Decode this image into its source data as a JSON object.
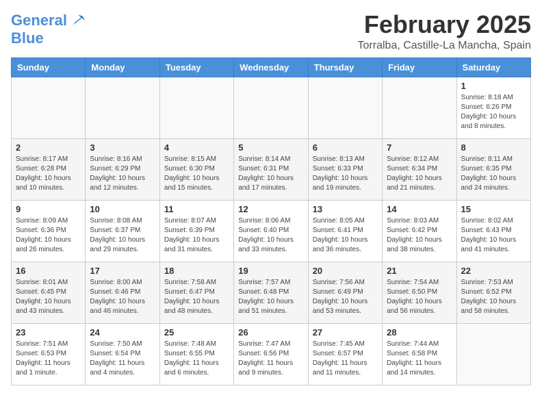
{
  "header": {
    "logo_line1": "General",
    "logo_line2": "Blue",
    "month": "February 2025",
    "location": "Torralba, Castille-La Mancha, Spain"
  },
  "weekdays": [
    "Sunday",
    "Monday",
    "Tuesday",
    "Wednesday",
    "Thursday",
    "Friday",
    "Saturday"
  ],
  "weeks": [
    {
      "shaded": false,
      "days": [
        {
          "num": "",
          "info": ""
        },
        {
          "num": "",
          "info": ""
        },
        {
          "num": "",
          "info": ""
        },
        {
          "num": "",
          "info": ""
        },
        {
          "num": "",
          "info": ""
        },
        {
          "num": "",
          "info": ""
        },
        {
          "num": "1",
          "info": "Sunrise: 8:18 AM\nSunset: 6:26 PM\nDaylight: 10 hours\nand 8 minutes."
        }
      ]
    },
    {
      "shaded": true,
      "days": [
        {
          "num": "2",
          "info": "Sunrise: 8:17 AM\nSunset: 6:28 PM\nDaylight: 10 hours\nand 10 minutes."
        },
        {
          "num": "3",
          "info": "Sunrise: 8:16 AM\nSunset: 6:29 PM\nDaylight: 10 hours\nand 12 minutes."
        },
        {
          "num": "4",
          "info": "Sunrise: 8:15 AM\nSunset: 6:30 PM\nDaylight: 10 hours\nand 15 minutes."
        },
        {
          "num": "5",
          "info": "Sunrise: 8:14 AM\nSunset: 6:31 PM\nDaylight: 10 hours\nand 17 minutes."
        },
        {
          "num": "6",
          "info": "Sunrise: 8:13 AM\nSunset: 6:33 PM\nDaylight: 10 hours\nand 19 minutes."
        },
        {
          "num": "7",
          "info": "Sunrise: 8:12 AM\nSunset: 6:34 PM\nDaylight: 10 hours\nand 21 minutes."
        },
        {
          "num": "8",
          "info": "Sunrise: 8:11 AM\nSunset: 6:35 PM\nDaylight: 10 hours\nand 24 minutes."
        }
      ]
    },
    {
      "shaded": false,
      "days": [
        {
          "num": "9",
          "info": "Sunrise: 8:09 AM\nSunset: 6:36 PM\nDaylight: 10 hours\nand 26 minutes."
        },
        {
          "num": "10",
          "info": "Sunrise: 8:08 AM\nSunset: 6:37 PM\nDaylight: 10 hours\nand 29 minutes."
        },
        {
          "num": "11",
          "info": "Sunrise: 8:07 AM\nSunset: 6:39 PM\nDaylight: 10 hours\nand 31 minutes."
        },
        {
          "num": "12",
          "info": "Sunrise: 8:06 AM\nSunset: 6:40 PM\nDaylight: 10 hours\nand 33 minutes."
        },
        {
          "num": "13",
          "info": "Sunrise: 8:05 AM\nSunset: 6:41 PM\nDaylight: 10 hours\nand 36 minutes."
        },
        {
          "num": "14",
          "info": "Sunrise: 8:03 AM\nSunset: 6:42 PM\nDaylight: 10 hours\nand 38 minutes."
        },
        {
          "num": "15",
          "info": "Sunrise: 8:02 AM\nSunset: 6:43 PM\nDaylight: 10 hours\nand 41 minutes."
        }
      ]
    },
    {
      "shaded": true,
      "days": [
        {
          "num": "16",
          "info": "Sunrise: 8:01 AM\nSunset: 6:45 PM\nDaylight: 10 hours\nand 43 minutes."
        },
        {
          "num": "17",
          "info": "Sunrise: 8:00 AM\nSunset: 6:46 PM\nDaylight: 10 hours\nand 46 minutes."
        },
        {
          "num": "18",
          "info": "Sunrise: 7:58 AM\nSunset: 6:47 PM\nDaylight: 10 hours\nand 48 minutes."
        },
        {
          "num": "19",
          "info": "Sunrise: 7:57 AM\nSunset: 6:48 PM\nDaylight: 10 hours\nand 51 minutes."
        },
        {
          "num": "20",
          "info": "Sunrise: 7:56 AM\nSunset: 6:49 PM\nDaylight: 10 hours\nand 53 minutes."
        },
        {
          "num": "21",
          "info": "Sunrise: 7:54 AM\nSunset: 6:50 PM\nDaylight: 10 hours\nand 56 minutes."
        },
        {
          "num": "22",
          "info": "Sunrise: 7:53 AM\nSunset: 6:52 PM\nDaylight: 10 hours\nand 58 minutes."
        }
      ]
    },
    {
      "shaded": false,
      "days": [
        {
          "num": "23",
          "info": "Sunrise: 7:51 AM\nSunset: 6:53 PM\nDaylight: 11 hours\nand 1 minute."
        },
        {
          "num": "24",
          "info": "Sunrise: 7:50 AM\nSunset: 6:54 PM\nDaylight: 11 hours\nand 4 minutes."
        },
        {
          "num": "25",
          "info": "Sunrise: 7:48 AM\nSunset: 6:55 PM\nDaylight: 11 hours\nand 6 minutes."
        },
        {
          "num": "26",
          "info": "Sunrise: 7:47 AM\nSunset: 6:56 PM\nDaylight: 11 hours\nand 9 minutes."
        },
        {
          "num": "27",
          "info": "Sunrise: 7:45 AM\nSunset: 6:57 PM\nDaylight: 11 hours\nand 11 minutes."
        },
        {
          "num": "28",
          "info": "Sunrise: 7:44 AM\nSunset: 6:58 PM\nDaylight: 11 hours\nand 14 minutes."
        },
        {
          "num": "",
          "info": ""
        }
      ]
    }
  ]
}
